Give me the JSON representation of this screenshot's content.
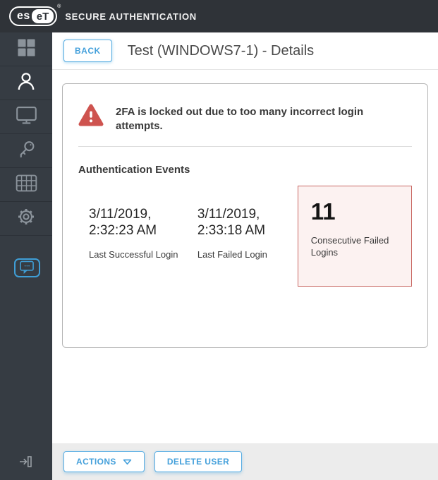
{
  "topbar": {
    "logo": {
      "left": "es",
      "right": "eT",
      "reg": "®"
    },
    "brand": "SECURE AUTHENTICATION"
  },
  "header": {
    "back": "BACK",
    "title": "Test (WINDOWS7-1) - Details"
  },
  "card": {
    "warning": "2FA is locked out due to too many incorrect login attempts.",
    "section_title": "Authentication Events",
    "events": [
      {
        "value": "3/11/2019, 2:32:23 AM",
        "label": "Last Successful Login"
      },
      {
        "value": "3/11/2019, 2:33:18 AM",
        "label": "Last Failed Login"
      },
      {
        "value": "11",
        "label": "Consecutive Failed Logins"
      }
    ]
  },
  "footer": {
    "actions": "ACTIONS",
    "delete_user": "DELETE USER"
  },
  "icons": {
    "sidebar": [
      "dashboard-grid",
      "user-person",
      "computer-monitor",
      "credential-key",
      "token-grid",
      "settings-gear"
    ],
    "feedback": "chat-bubble",
    "collapse": "arrow-to-bar",
    "warning": "alert-triangle",
    "actions_caret": "chevron-down-outline"
  },
  "colors": {
    "topbar_bg": "#2f3338",
    "sidebar_bg": "#363c43",
    "accent_blue": "#44a0db",
    "warning_red": "#ce534f",
    "highlight_bg": "#fcf2f1",
    "highlight_border": "#c96964",
    "footer_bg": "#ececec"
  }
}
